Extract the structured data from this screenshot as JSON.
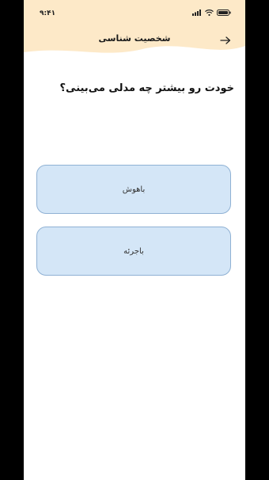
{
  "status_bar": {
    "time": "۹:۴۱"
  },
  "header": {
    "title": "شخصیت شناسی",
    "background_color": "#fde9c8"
  },
  "question": {
    "text": "خودت رو بیشتر چه مدلی می‌بینی؟"
  },
  "options": [
    {
      "label": "باهوش"
    },
    {
      "label": "باجرئه"
    }
  ],
  "colors": {
    "option_fill": "#d4e6f7",
    "option_border": "#8fb1d4"
  }
}
